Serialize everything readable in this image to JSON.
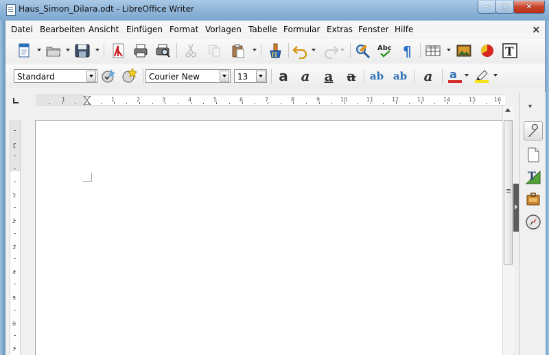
{
  "window": {
    "title": "Haus_Simon_Dilara.odt - LibreOffice Writer"
  },
  "menu": [
    "Datei",
    "Bearbeiten",
    "Ansicht",
    "Einfügen",
    "Format",
    "Vorlagen",
    "Tabelle",
    "Formular",
    "Extras",
    "Fenster",
    "Hilfe"
  ],
  "menu_close": "×",
  "toolbar_standard": {
    "icons": [
      "new-document-icon",
      "open-folder-icon",
      "save-icon",
      "export-pdf-icon",
      "print-icon",
      "print-preview-icon",
      "cut-icon",
      "copy-icon",
      "paste-icon",
      "clone-formatting-icon",
      "undo-icon",
      "redo-icon",
      "find-replace-icon",
      "spelling-icon",
      "formatting-marks-icon",
      "insert-table-icon",
      "insert-image-icon",
      "insert-chart-icon",
      "insert-textbox-icon"
    ]
  },
  "toolbar_formatting": {
    "paragraph_style": "Standard",
    "font_name": "Courier New",
    "font_size": "13",
    "format_glyphs": {
      "bold": "a",
      "italic": "a",
      "underline": "a",
      "strike": "a",
      "superscript": "ab",
      "subscript": "ab",
      "clear": "a"
    },
    "colors": {
      "font_color": "#d42a2a",
      "highlight": "#f5e31a",
      "accent_blue": "#2e6fb7"
    }
  },
  "ruler": {
    "h_numbers": [
      "1",
      "1",
      "2",
      "3",
      "4",
      "5",
      "6",
      "7",
      "8",
      "9",
      "10",
      "11",
      "12",
      "13",
      "14",
      "15",
      "16"
    ],
    "v_numbers": [
      "1",
      "1",
      "2",
      "3",
      "4",
      "5",
      "6",
      "7"
    ]
  },
  "sidebar": {
    "icons": [
      "sidebar-menu-icon",
      "properties-icon",
      "page-icon",
      "styles-icon",
      "gallery-icon",
      "navigator-icon"
    ]
  }
}
